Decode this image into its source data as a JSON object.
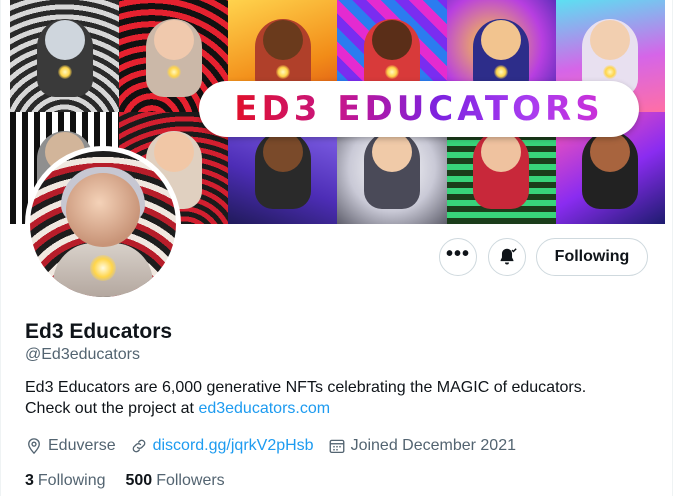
{
  "banner": {
    "title_text": "ED3 EDUCATORS",
    "tile_count": 12
  },
  "actions": {
    "more_label": "•••",
    "following_label": "Following"
  },
  "profile": {
    "name": "Ed3 Educators",
    "handle": "@Ed3educators",
    "bio_line1": "Ed3 Educators are 6,000 generative NFTs celebrating the MAGIC of educators.",
    "bio_line2_prefix": "Check out the project at ",
    "bio_link": "ed3educators.com",
    "location": "Eduverse",
    "website": "discord.gg/jqrkV2pHsb",
    "joined": "Joined December 2021"
  },
  "stats": {
    "following_count": "3",
    "following_label": "Following",
    "followers_count": "500",
    "followers_label": "Followers"
  },
  "colors": {
    "link": "#1d9bf0",
    "secondary_text": "#536471",
    "primary_text": "#0f1419",
    "border": "#cfd9de"
  },
  "icons": [
    "more-icon",
    "bell-icon",
    "location-icon",
    "link-icon",
    "calendar-icon"
  ]
}
